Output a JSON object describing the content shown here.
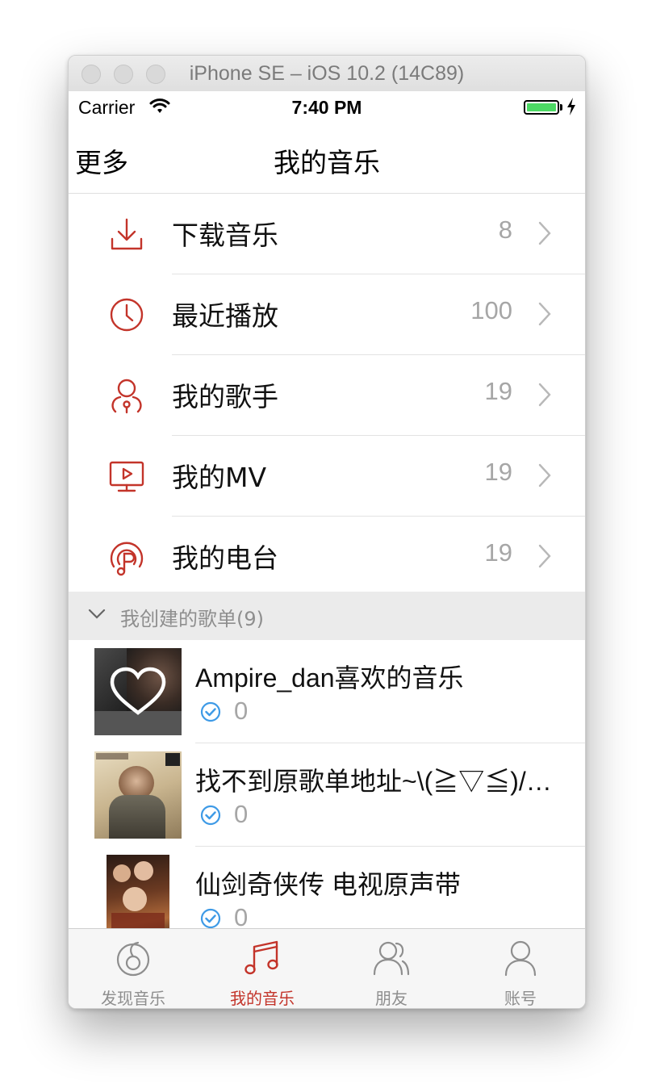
{
  "window": {
    "title": "iPhone SE – iOS 10.2 (14C89)"
  },
  "status_bar": {
    "carrier": "Carrier",
    "time": "7:40 PM"
  },
  "navbar": {
    "left_button": "更多",
    "title": "我的音乐"
  },
  "menu": [
    {
      "label": "下载音乐",
      "count": "8",
      "icon": "download-icon"
    },
    {
      "label": "最近播放",
      "count": "100",
      "icon": "clock-icon"
    },
    {
      "label": "我的歌手",
      "count": "19",
      "icon": "singer-icon"
    },
    {
      "label": "我的MV",
      "count": "19",
      "icon": "mv-icon"
    },
    {
      "label": "我的电台",
      "count": "19",
      "icon": "radio-icon"
    }
  ],
  "section": {
    "title": "我创建的歌单(9)"
  },
  "playlists": [
    {
      "name": "Ampire_dan喜欢的音乐",
      "count": "0"
    },
    {
      "name": "找不到原歌单地址~\\(≧▽≦)/~啦啦啦",
      "count": "0"
    },
    {
      "name": "仙剑奇侠传 电视原声带",
      "count": "0"
    }
  ],
  "tabbar": [
    {
      "label": "发现音乐",
      "icon": "discover-icon",
      "active": false
    },
    {
      "label": "我的音乐",
      "icon": "music-note-icon",
      "active": true
    },
    {
      "label": "朋友",
      "icon": "friends-icon",
      "active": false
    },
    {
      "label": "账号",
      "icon": "account-icon",
      "active": false
    }
  ],
  "colors": {
    "accent": "#c3342a",
    "secondary_text": "#a6a6a6",
    "section_bg": "#ebebeb",
    "check_blue": "#3e9ae6"
  }
}
